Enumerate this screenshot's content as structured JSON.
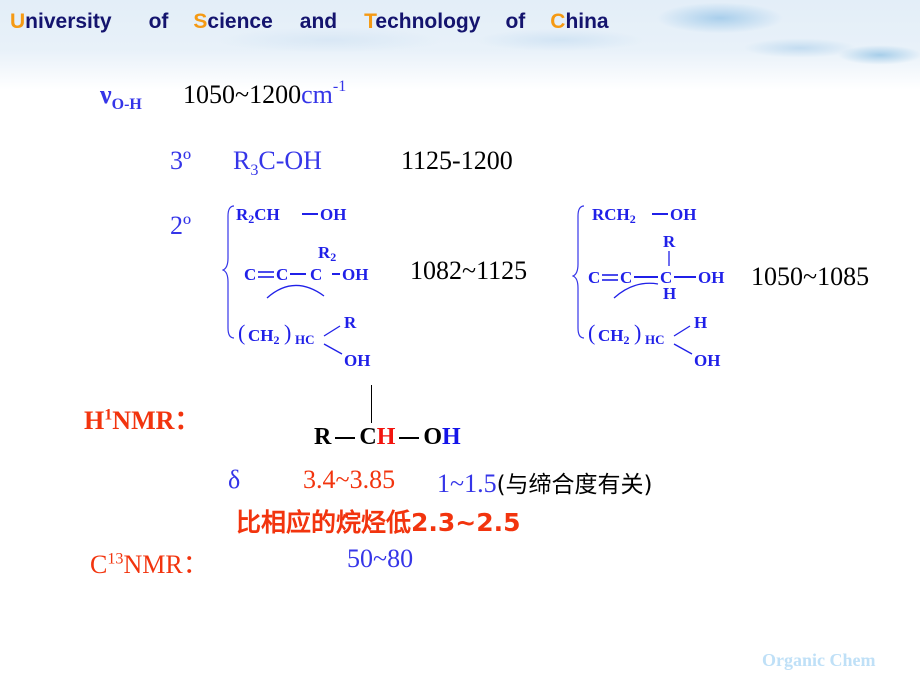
{
  "header": {
    "words": [
      {
        "initial": "U",
        "rest": "niversity"
      },
      {
        "initial": "",
        "rest": "of"
      },
      {
        "initial": "S",
        "rest": "cience"
      },
      {
        "initial": "",
        "rest": "and"
      },
      {
        "initial": "T",
        "rest": "echnology"
      },
      {
        "initial": "",
        "rest": "of"
      },
      {
        "initial": "C",
        "rest": "hina"
      }
    ]
  },
  "ir": {
    "symbol": "ν",
    "subscript": "O-H",
    "range": "1050~1200",
    "unit": "cm",
    "unit_sup": "-1",
    "tertiary": {
      "label": "3º",
      "formula_pre": "R",
      "formula_sub": "3",
      "formula_post": "C-OH",
      "range": "1125-1200"
    },
    "secondary": {
      "label": "2º",
      "structures": [
        "R₂CH—OH",
        "C=C—C(R₂)—OH",
        "(CH₂)HC(R)OH"
      ],
      "range": "1082~1125"
    },
    "primary": {
      "structures": [
        "RCH₂—OH",
        "C=C—C(R)(H)—OH",
        "(CH₂)HC(H)OH"
      ],
      "range": "1050~1085"
    }
  },
  "h_nmr": {
    "label_pre": "H",
    "label_sup": "1",
    "label_post": "NMR：",
    "structure": {
      "r": "R",
      "c": "C",
      "h": "H",
      "oh_o": "O",
      "oh_h": "H"
    },
    "delta": "δ",
    "ch_shift": "3.4~3.85",
    "oh_shift": "1~1.5",
    "oh_note": "(与缔合度有关)",
    "comparison": "比相应的烷烃低2.3~2.5"
  },
  "c_nmr": {
    "label_pre": "C",
    "label_sup": "13",
    "label_post": "NMR：",
    "shift": "50~80"
  },
  "watermark": "Organic Chem",
  "colors": {
    "blue": "#3535e8",
    "red": "#f2340e",
    "navy": "#14146e",
    "orange": "#f59a14"
  }
}
